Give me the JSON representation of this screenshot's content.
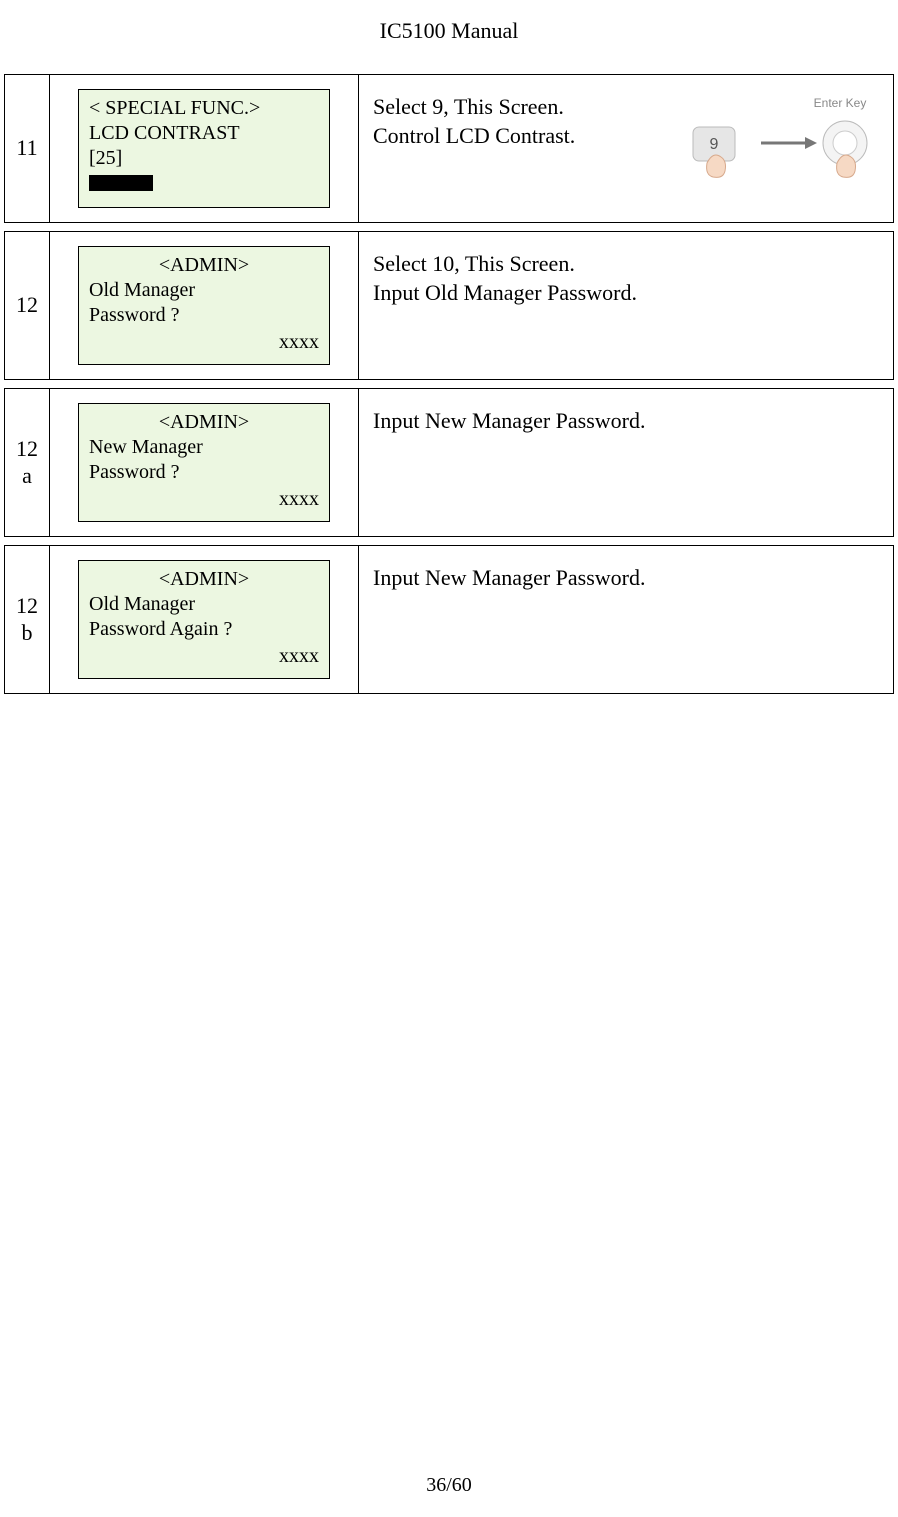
{
  "header": {
    "title": "IC5100 Manual"
  },
  "footer": {
    "page": "36/60"
  },
  "rows": [
    {
      "step": "11",
      "lcd": {
        "header": "< SPECIAL FUNC.>",
        "header_align": "left",
        "line1": "LCD CONTRAST",
        "line2": "[25]",
        "has_bar": true
      },
      "description": "Select 9, This Screen.\nControl LCD Contrast.",
      "has_key_image": true,
      "key_label": "Enter Key",
      "key_digit": "9"
    },
    {
      "step": "12",
      "lcd": {
        "header": "<ADMIN>",
        "header_align": "center",
        "line1": "Old Manager",
        "line2": "Password ?",
        "input": "xxxx"
      },
      "description": "Select 10, This Screen.\nInput Old Manager Password."
    },
    {
      "step": "12\na",
      "lcd": {
        "header": "<ADMIN>",
        "header_align": "center",
        "line1": "New Manager",
        "line2": "Password ?",
        "input": "xxxx"
      },
      "description": "Input New Manager Password."
    },
    {
      "step": "12\nb",
      "lcd": {
        "header": "<ADMIN>",
        "header_align": "center",
        "line1": "Old Manager",
        "line2": "Password Again ?",
        "input": "xxxx"
      },
      "description": "Input New Manager Password."
    }
  ]
}
